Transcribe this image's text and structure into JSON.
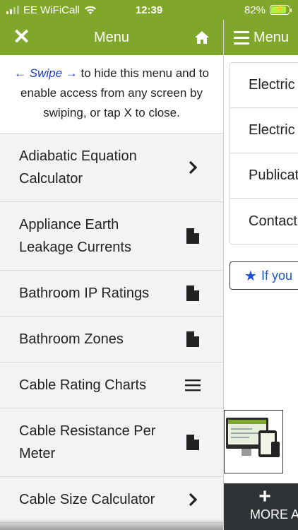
{
  "status_bar": {
    "carrier": "EE WiFiCall",
    "time": "12:39",
    "battery": "82%",
    "battery_level": 0.82,
    "battery_color": "#b4f33b"
  },
  "menu": {
    "title": "Menu",
    "close_icon": "close-icon",
    "home_icon": "home-icon",
    "hint": {
      "swipe": "← Swipe →",
      "text": " to hide this menu and to enable access from any screen by swiping, or tap X to close."
    },
    "items": [
      {
        "label": "Adiabatic Equation Calculator",
        "icon": "chevron-right-icon"
      },
      {
        "label": "Appliance Earth Leakage Currents",
        "icon": "document-icon"
      },
      {
        "label": "Bathroom IP Ratings",
        "icon": "document-icon"
      },
      {
        "label": "Bathroom Zones",
        "icon": "document-icon"
      },
      {
        "label": "Cable Rating Charts",
        "icon": "list-icon"
      },
      {
        "label": "Cable Resistance Per Meter",
        "icon": "document-icon"
      },
      {
        "label": "Cable Size Calculator",
        "icon": "chevron-right-icon"
      }
    ]
  },
  "background_page": {
    "header_title": "Menu",
    "list_items": [
      "Electric",
      "Electric",
      "Publicat",
      "Contact"
    ],
    "rate_button": "If you",
    "more_apps": "MORE AP"
  },
  "colors": {
    "brand_green": "#80a72a",
    "link_blue": "#1c3fc9",
    "menu_background": "#f3f3f5",
    "footer_dark": "#2f3235"
  }
}
